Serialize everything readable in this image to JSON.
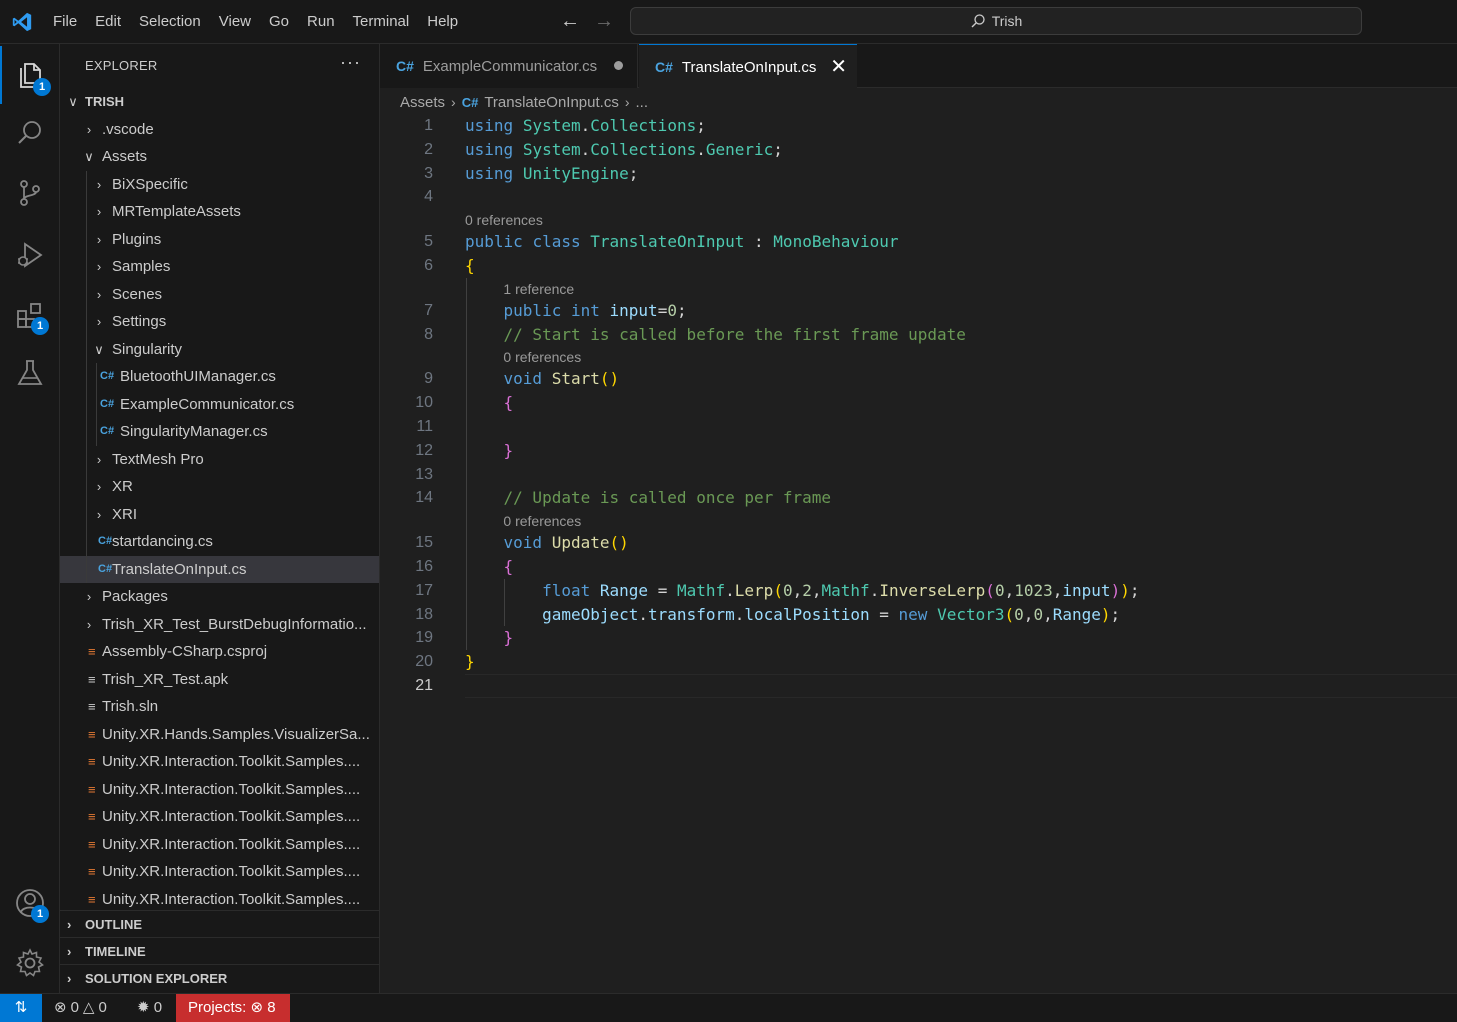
{
  "menu": [
    "File",
    "Edit",
    "Selection",
    "View",
    "Go",
    "Run",
    "Terminal",
    "Help"
  ],
  "command_center": "Trish",
  "activity": {
    "explorer_badge": "1",
    "extensions_badge": "1",
    "accounts_badge": "1"
  },
  "sidebar": {
    "title": "EXPLORER",
    "more": "···",
    "root": "TRISH",
    "items": [
      {
        "label": ".vscode",
        "kind": "folder",
        "open": false,
        "depth": 1
      },
      {
        "label": "Assets",
        "kind": "folder",
        "open": true,
        "depth": 1
      },
      {
        "label": "BiXSpecific",
        "kind": "folder",
        "open": false,
        "depth": 2
      },
      {
        "label": "MRTemplateAssets",
        "kind": "folder",
        "open": false,
        "depth": 2
      },
      {
        "label": "Plugins",
        "kind": "folder",
        "open": false,
        "depth": 2
      },
      {
        "label": "Samples",
        "kind": "folder",
        "open": false,
        "depth": 2
      },
      {
        "label": "Scenes",
        "kind": "folder",
        "open": false,
        "depth": 2
      },
      {
        "label": "Settings",
        "kind": "folder",
        "open": false,
        "depth": 2
      },
      {
        "label": "Singularity",
        "kind": "folder",
        "open": true,
        "depth": 2
      },
      {
        "label": "BluetoothUIManager.cs",
        "kind": "cs",
        "depth": 3
      },
      {
        "label": "ExampleCommunicator.cs",
        "kind": "cs",
        "depth": 3
      },
      {
        "label": "SingularityManager.cs",
        "kind": "cs",
        "depth": 3
      },
      {
        "label": "TextMesh Pro",
        "kind": "folder",
        "open": false,
        "depth": 2
      },
      {
        "label": "XR",
        "kind": "folder",
        "open": false,
        "depth": 2
      },
      {
        "label": "XRI",
        "kind": "folder",
        "open": false,
        "depth": 2
      },
      {
        "label": "startdancing.cs",
        "kind": "cs",
        "depth": 2
      },
      {
        "label": "TranslateOnInput.cs",
        "kind": "cs",
        "depth": 2,
        "selected": true
      },
      {
        "label": "Packages",
        "kind": "folder",
        "open": false,
        "depth": 1
      },
      {
        "label": "Trish_XR_Test_BurstDebugInformatio...",
        "kind": "folder",
        "open": false,
        "depth": 1
      },
      {
        "label": "Assembly-CSharp.csproj",
        "kind": "rss",
        "depth": 1
      },
      {
        "label": "Trish_XR_Test.apk",
        "kind": "lines",
        "depth": 1
      },
      {
        "label": "Trish.sln",
        "kind": "lines",
        "depth": 1
      },
      {
        "label": "Unity.XR.Hands.Samples.VisualizerSa...",
        "kind": "rss",
        "depth": 1
      },
      {
        "label": "Unity.XR.Interaction.Toolkit.Samples....",
        "kind": "rss",
        "depth": 1
      },
      {
        "label": "Unity.XR.Interaction.Toolkit.Samples....",
        "kind": "rss",
        "depth": 1
      },
      {
        "label": "Unity.XR.Interaction.Toolkit.Samples....",
        "kind": "rss",
        "depth": 1
      },
      {
        "label": "Unity.XR.Interaction.Toolkit.Samples....",
        "kind": "rss",
        "depth": 1
      },
      {
        "label": "Unity.XR.Interaction.Toolkit.Samples....",
        "kind": "rss",
        "depth": 1
      },
      {
        "label": "Unity.XR.Interaction.Toolkit.Samples....",
        "kind": "rss",
        "depth": 1
      }
    ],
    "sections": [
      "OUTLINE",
      "TIMELINE",
      "SOLUTION EXPLORER"
    ]
  },
  "tabs": [
    {
      "label": "ExampleCommunicator.cs",
      "active": false,
      "dirty": true
    },
    {
      "label": "TranslateOnInput.cs",
      "active": true,
      "dirty": false
    }
  ],
  "breadcrumb": [
    "Assets",
    "TranslateOnInput.cs",
    "..."
  ],
  "codelens": [
    "0 references",
    "1 reference",
    "0 references",
    "0 references"
  ],
  "code_lines": [
    "using System.Collections;",
    "using System.Collections.Generic;",
    "using UnityEngine;",
    "",
    "public class TranslateOnInput : MonoBehaviour",
    "{",
    "    public int input=0;",
    "    // Start is called before the first frame update",
    "    void Start()",
    "    {",
    "",
    "    }",
    "",
    "    // Update is called once per frame",
    "    void Update()",
    "    {",
    "        float Range = Mathf.Lerp(0,2,Mathf.InverseLerp(0,1023,input));",
    "        gameObject.transform.localPosition = new Vector3(0,0,Range);",
    "    }",
    "}",
    ""
  ],
  "status": {
    "errors": "0",
    "warnings": "0",
    "ports": "0",
    "projects_label": "Projects:",
    "projects_errors": "8"
  },
  "colors": {
    "accent": "#0078d4",
    "projects_bg": "#c72e2e",
    "cs_icon": "#4aa3df",
    "rss_icon": "#e37933"
  }
}
